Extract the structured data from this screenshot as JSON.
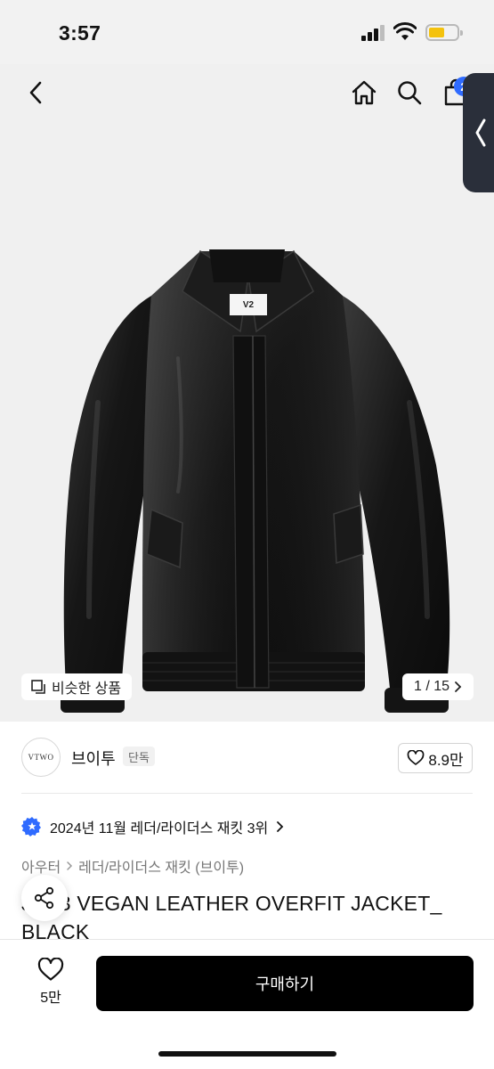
{
  "status_bar": {
    "time": "3:57"
  },
  "nav": {
    "cart_count": "2"
  },
  "gallery": {
    "similar_label": "비슷한 상품",
    "page_counter": "1 / 15",
    "badge_text": "V2"
  },
  "brand": {
    "logo_text": "VTWO",
    "name": "브이투",
    "tag": "단독",
    "likes": "8.9만"
  },
  "ranking": {
    "text": "2024년 11월 레더/라이더스 재킷 3위"
  },
  "breadcrumb": {
    "category": "아우터",
    "subcategory": "레더/라이더스 재킷 (브이투)"
  },
  "product": {
    "title": "J⋯-3 VEGAN LEATHER OVERFIT JACKET_ BLACK"
  },
  "bottom_bar": {
    "wish_count": "5만",
    "buy_label": "구매하기"
  },
  "colors": {
    "accent": "#2f6bff",
    "battery": "#f4c20d",
    "buy_button": "#000000"
  }
}
